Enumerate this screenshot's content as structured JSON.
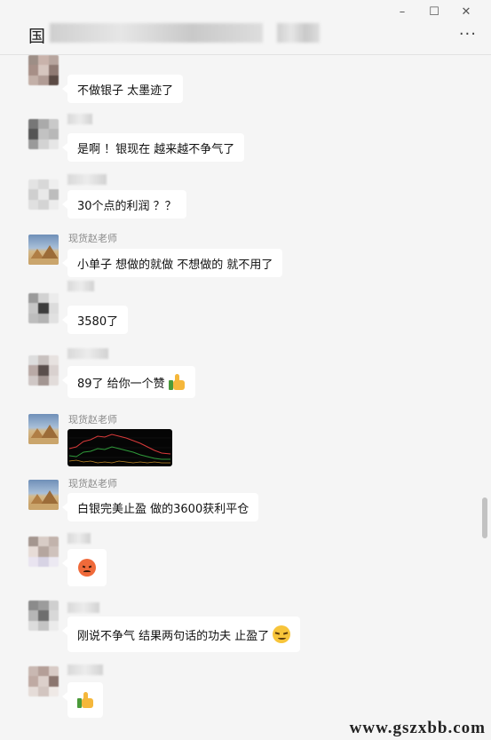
{
  "window": {
    "title": "国",
    "controls": {
      "minimize": "–",
      "maximize": "☐",
      "close": "✕"
    },
    "more_label": "···"
  },
  "messages": [
    {
      "sender": "",
      "text": "不做银子 太墨迹了"
    },
    {
      "sender": "",
      "text": "是啊 ！银现在 越来越不争气了"
    },
    {
      "sender": "",
      "text": "30个点的利润 ？？"
    },
    {
      "sender": "现货赵老师",
      "text": "小单子  想做的就做 不想做的 就不用了"
    },
    {
      "sender": "",
      "text": "3580了"
    },
    {
      "sender": "",
      "text": "89了 给你一个赞",
      "emoji": "thumbs-up"
    },
    {
      "sender": "现货赵老师",
      "image": "price-chart"
    },
    {
      "sender": "现货赵老师",
      "text": "白银完美止盈 做的3600获利平仓"
    },
    {
      "sender": "",
      "emoji": "angry-face"
    },
    {
      "sender": "",
      "text": "刚说不争气 结果两句话的功夫 止盈了",
      "emoji": "smirk-face"
    },
    {
      "sender": "",
      "emoji": "thumbs-up"
    }
  ],
  "watermark": "www.gszxbb.com",
  "colors": {
    "bubble": "#ffffff",
    "background": "#f5f5f5",
    "chart_line_red": "#d93a3a",
    "chart_line_green": "#2f9a3a"
  }
}
